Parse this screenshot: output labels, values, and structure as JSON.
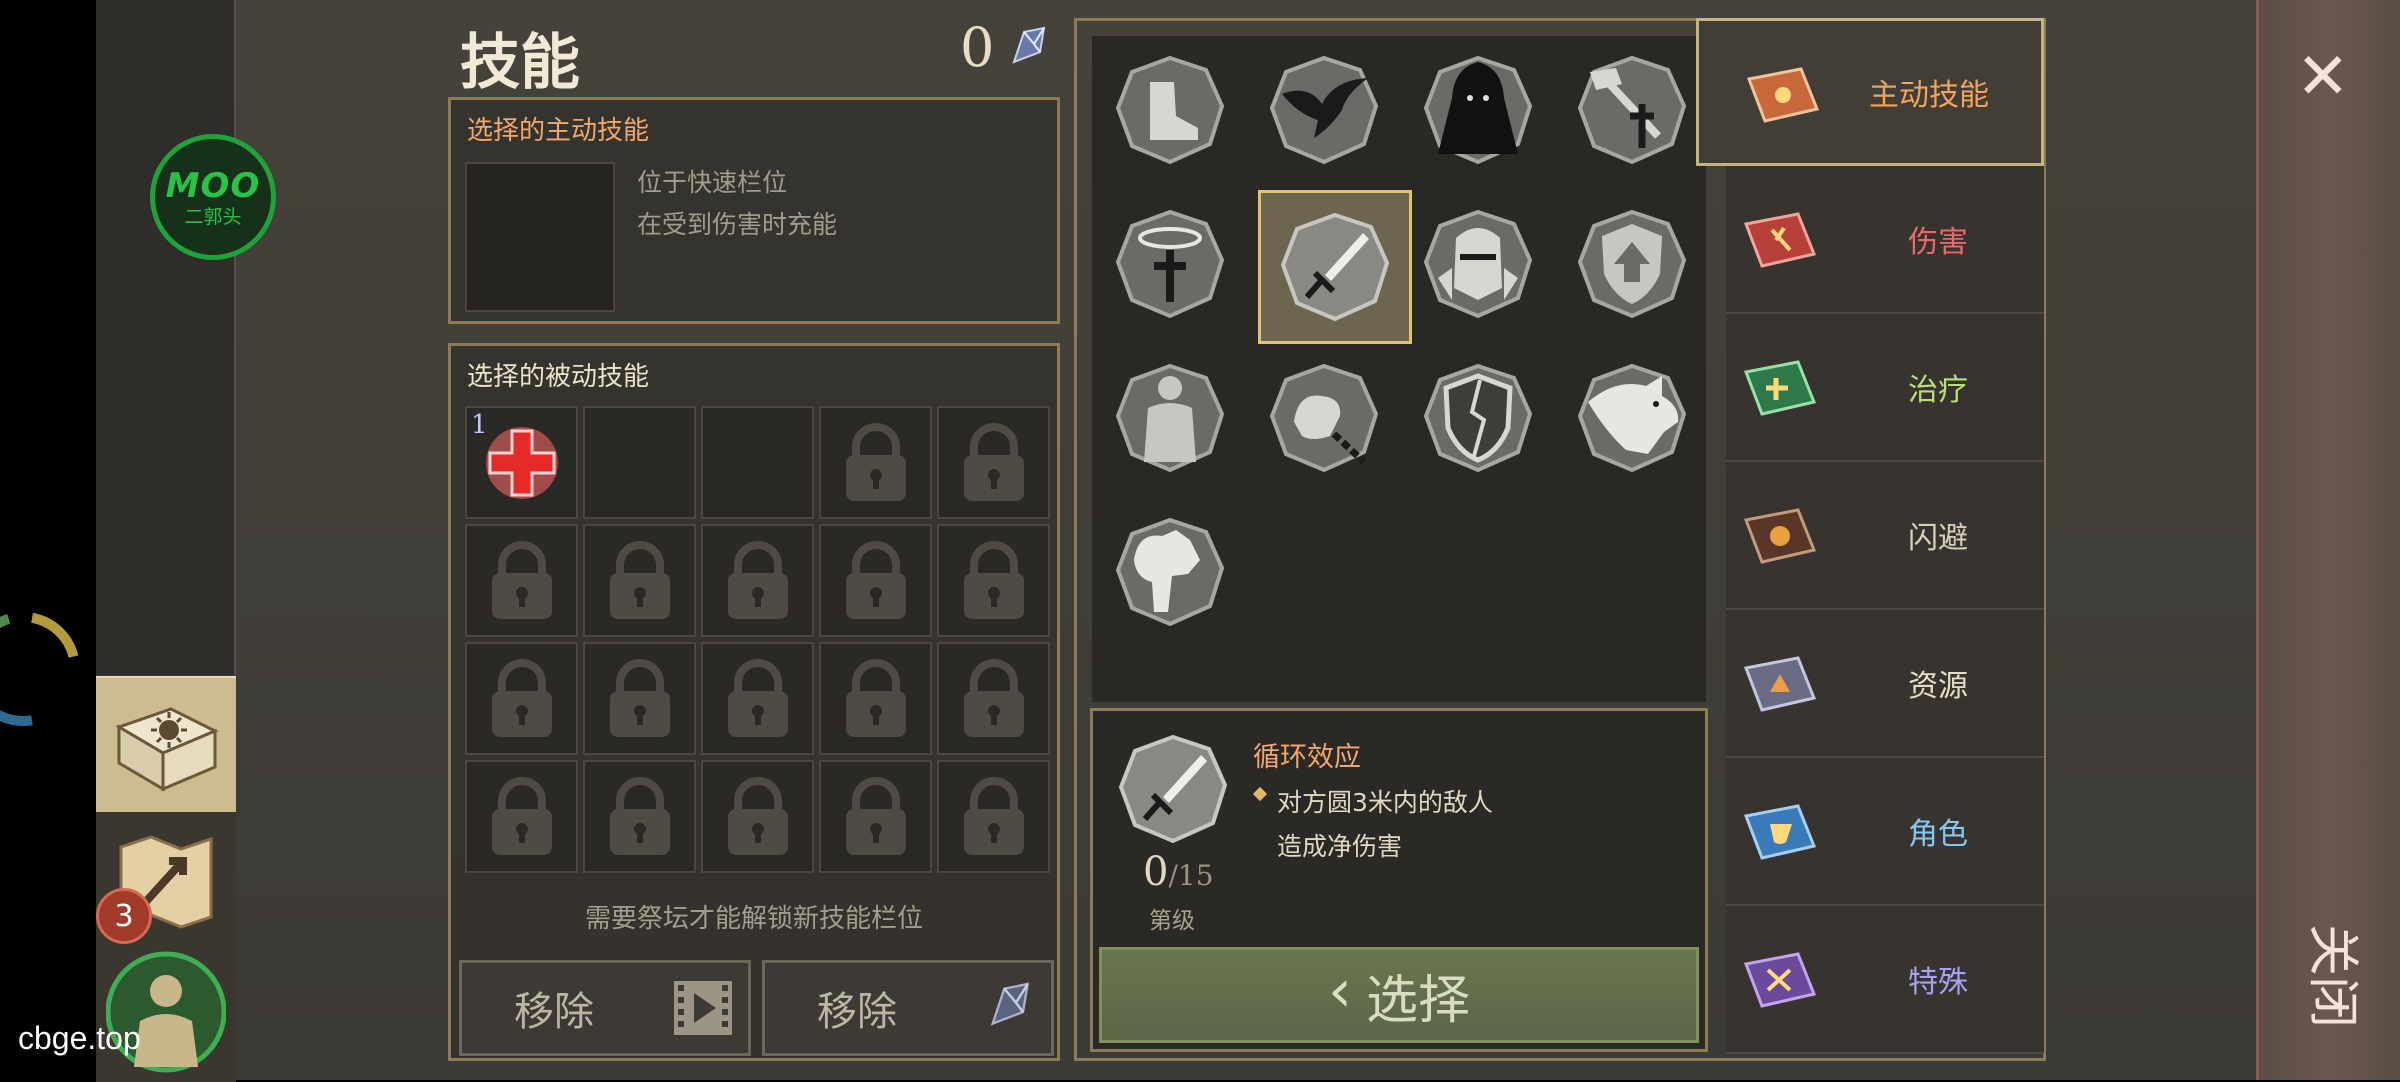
{
  "header": {
    "title": "技能",
    "gem_count": "0"
  },
  "active_panel": {
    "title": "选择的主动技能",
    "desc_line1": "位于快速栏位",
    "desc_line2": "在受到伤害时充能"
  },
  "passive_panel": {
    "title": "选择的被动技能",
    "slot1_level": "1",
    "unlock_note": "需要祭坛才能解锁新技能栏位",
    "remove_video_label": "移除",
    "remove_gem_label": "移除"
  },
  "overlay": {
    "moo_logo": "MOO",
    "moo_sub": "二郭头",
    "side_badge": "3",
    "watermark": "cbge.top"
  },
  "skill_detail": {
    "name": "循环效应",
    "line1": "对方圆3米内的敌人",
    "line2": "造成净伤害",
    "level": "0",
    "level_max": "/15",
    "level_label": "第级",
    "select_label": "选择"
  },
  "tabs": [
    {
      "label": "主动技能",
      "color": "#f0a55b",
      "book": "#c8683a"
    },
    {
      "label": "伤害",
      "color": "#e86a6a",
      "book": "#b8403a"
    },
    {
      "label": "治疗",
      "color": "#b7e07a",
      "book": "#2e7a4a"
    },
    {
      "label": "闪避",
      "color": "#d9cfb9",
      "book": "#5a3628"
    },
    {
      "label": "资源",
      "color": "#e7ddc7",
      "book": "#6a6c86"
    },
    {
      "label": "角色",
      "color": "#88c7f2",
      "book": "#3a7ab8"
    },
    {
      "label": "特殊",
      "color": "#a9a2f0",
      "book": "#6a4a9a"
    }
  ],
  "close": {
    "label": "关闭"
  },
  "colors": {
    "accent_orange": "#f2a86a",
    "frame_gold": "#8e7a55",
    "select_green": "#6a7550"
  }
}
